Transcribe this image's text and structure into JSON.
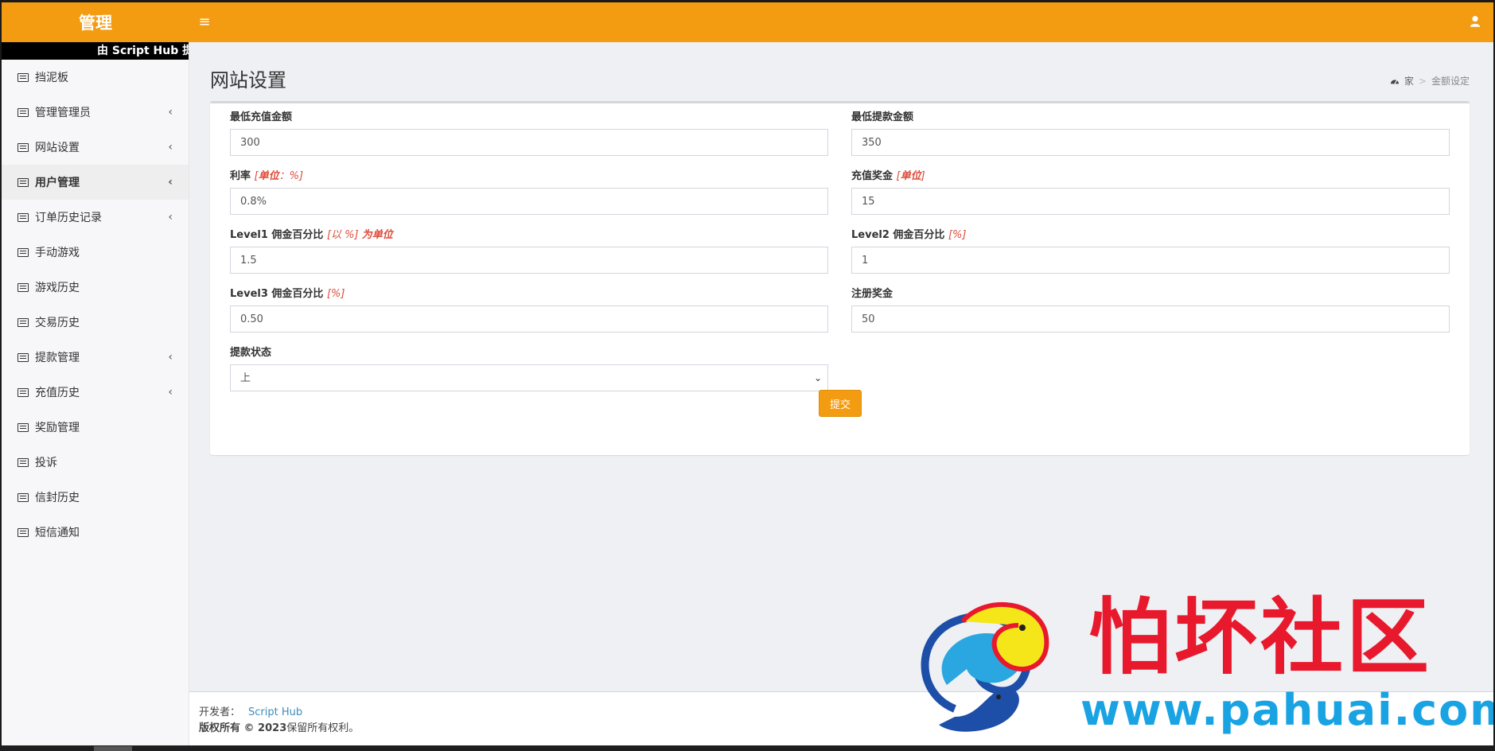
{
  "brand": {
    "title": "管理",
    "color": "#f39c12"
  },
  "marquee": {
    "text": "由 Script Hub 提供支持"
  },
  "sidebar": {
    "items": [
      {
        "label": "挡泥板",
        "has_children": false,
        "active": false
      },
      {
        "label": "管理管理员",
        "has_children": true,
        "active": false
      },
      {
        "label": "网站设置",
        "has_children": true,
        "active": false
      },
      {
        "label": "用户管理",
        "has_children": true,
        "active": true
      },
      {
        "label": "订单历史记录",
        "has_children": true,
        "active": false
      },
      {
        "label": "手动游戏",
        "has_children": false,
        "active": false
      },
      {
        "label": "游戏历史",
        "has_children": false,
        "active": false
      },
      {
        "label": "交易历史",
        "has_children": false,
        "active": false
      },
      {
        "label": "提款管理",
        "has_children": true,
        "active": false
      },
      {
        "label": "充值历史",
        "has_children": true,
        "active": false
      },
      {
        "label": "奖励管理",
        "has_children": false,
        "active": false
      },
      {
        "label": "投诉",
        "has_children": false,
        "active": false
      },
      {
        "label": "信封历史",
        "has_children": false,
        "active": false
      },
      {
        "label": "短信通知",
        "has_children": false,
        "active": false
      }
    ]
  },
  "page": {
    "title": "网站设置"
  },
  "breadcrumb": {
    "home": "家",
    "current": "金额设定"
  },
  "form": {
    "min_recharge": {
      "label": "最低充值金额",
      "value": "300"
    },
    "min_withdraw": {
      "label": "最低提款金额",
      "value": "350"
    },
    "interest": {
      "label": "利率",
      "unit_prefix": "[",
      "unit_bold": "单位",
      "unit_suffix": "：%]",
      "value": "0.8%"
    },
    "recharge_bonus": {
      "label": "充值奖金",
      "unit_prefix": "[",
      "unit_bold": "单位",
      "unit_suffix": "]",
      "value": "15"
    },
    "level1": {
      "label": "Level1 佣金百分比",
      "unit": "[以 %]",
      "unit_bold": "为单位",
      "value": "1.5"
    },
    "level2": {
      "label": "Level2 佣金百分比",
      "unit": "[%]",
      "value": "1"
    },
    "level3": {
      "label": "Level3 佣金百分比",
      "unit": "[%]",
      "value": "0.50"
    },
    "register_bonus": {
      "label": "注册奖金",
      "value": "50"
    },
    "withdraw_status": {
      "label": "提款状态",
      "selected": "上"
    },
    "submit_label": "提交"
  },
  "footer": {
    "developer_label": "开发者：",
    "developer_link": "Script Hub",
    "copyright_bold": "版权所有 © 2023",
    "copyright_rest": "保留所有权利。"
  },
  "watermark": {
    "title": "怕坏社区",
    "url": "www.pahuai.com"
  },
  "icons": {
    "menu": "list-icon",
    "home": "dashboard-icon",
    "user": "user-icon",
    "toggle": "hamburger-icon"
  }
}
